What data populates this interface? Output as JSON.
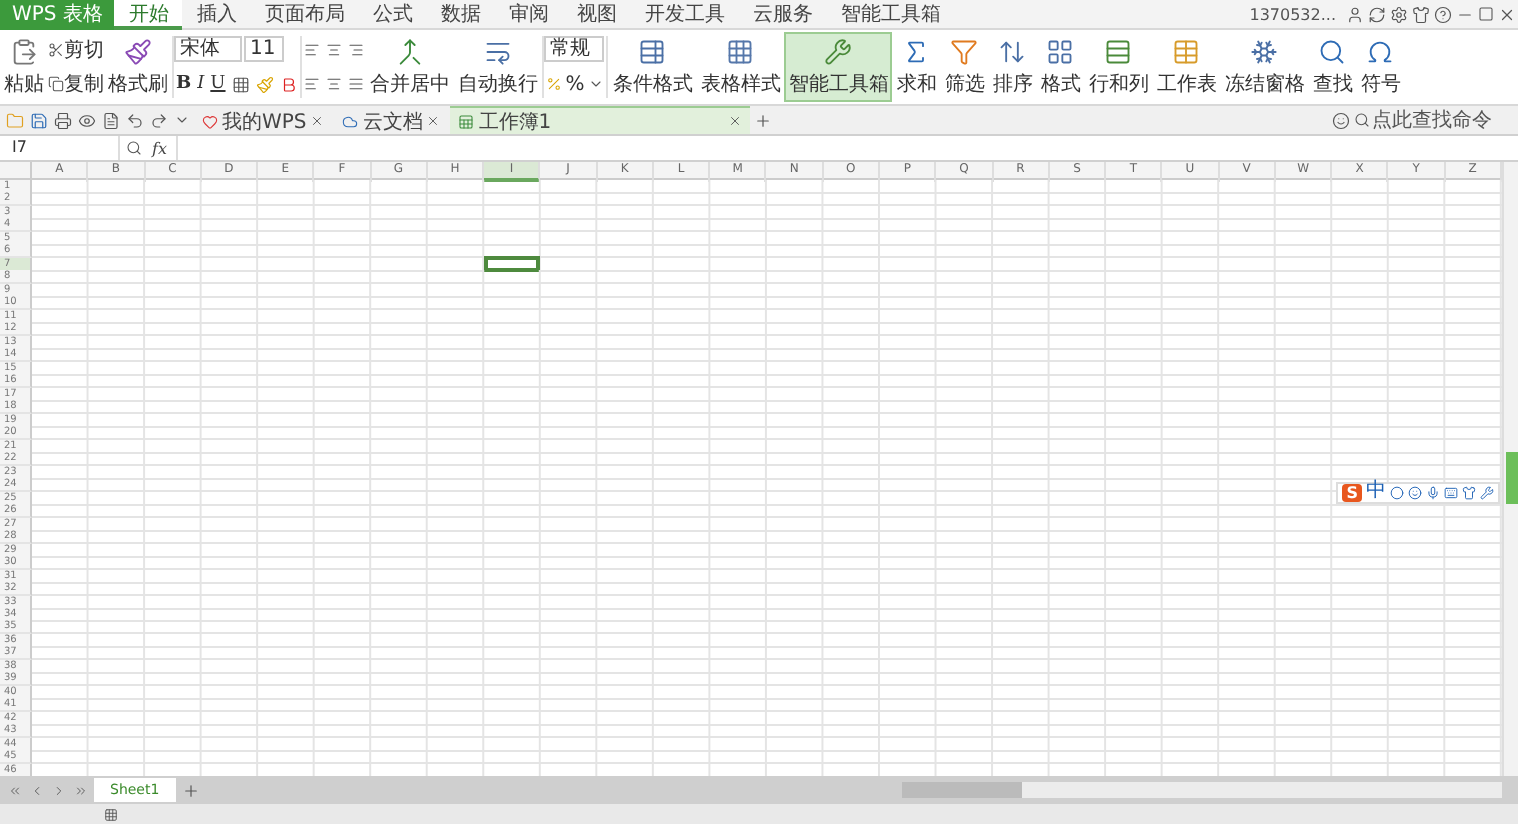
{
  "app_button": {
    "label": "WPS 表格"
  },
  "menu_tabs": [
    {
      "label": "开始",
      "selected": true
    },
    {
      "label": "插入",
      "selected": false
    },
    {
      "label": "页面布局",
      "selected": false
    },
    {
      "label": "公式",
      "selected": false
    },
    {
      "label": "数据",
      "selected": false
    },
    {
      "label": "审阅",
      "selected": false
    },
    {
      "label": "视图",
      "selected": false
    },
    {
      "label": "开发工具",
      "selected": false
    },
    {
      "label": "云服务",
      "selected": false
    },
    {
      "label": "智能工具箱",
      "selected": false
    }
  ],
  "user": {
    "name": "1370532..."
  },
  "ribbon": {
    "paste": "粘贴",
    "cut": "剪切",
    "copy": "复制",
    "format_painter": "格式刷",
    "font": "宋体",
    "font_size": "11",
    "format_letters": [
      "B",
      "I",
      "U"
    ],
    "big_buttons": [
      {
        "label": "合并居中",
        "selected": false
      },
      {
        "label": "自动换行",
        "selected": false
      }
    ],
    "number_format": "常规",
    "percent": "%",
    "tools": [
      {
        "label": "条件格式",
        "selected": false
      },
      {
        "label": "表格样式",
        "selected": false
      },
      {
        "label": "智能工具箱",
        "selected": true
      },
      {
        "label": "求和",
        "selected": false
      },
      {
        "label": "筛选",
        "selected": false
      },
      {
        "label": "排序",
        "selected": false
      },
      {
        "label": "格式",
        "selected": false
      },
      {
        "label": "行和列",
        "selected": false
      },
      {
        "label": "工作表",
        "selected": false
      },
      {
        "label": "冻结窗格",
        "selected": false
      },
      {
        "label": "查找",
        "selected": false
      },
      {
        "label": "符号",
        "selected": false
      }
    ]
  },
  "doc_tabs": [
    {
      "label": "我的WPS",
      "selected": false
    },
    {
      "label": "云文档",
      "selected": false
    },
    {
      "label": "工作簿1",
      "selected": true
    }
  ],
  "command_search": {
    "placeholder": "点此查找命令"
  },
  "formula_bar": {
    "name_box": "I7",
    "fx": "fx"
  },
  "columns": [
    {
      "label": "A",
      "selected": false
    },
    {
      "label": "B",
      "selected": false
    },
    {
      "label": "C",
      "selected": false
    },
    {
      "label": "D",
      "selected": false
    },
    {
      "label": "E",
      "selected": false
    },
    {
      "label": "F",
      "selected": false
    },
    {
      "label": "G",
      "selected": false
    },
    {
      "label": "H",
      "selected": false
    },
    {
      "label": "I",
      "selected": true
    },
    {
      "label": "J",
      "selected": false
    },
    {
      "label": "K",
      "selected": false
    },
    {
      "label": "L",
      "selected": false
    },
    {
      "label": "M",
      "selected": false
    },
    {
      "label": "N",
      "selected": false
    },
    {
      "label": "O",
      "selected": false
    },
    {
      "label": "P",
      "selected": false
    },
    {
      "label": "Q",
      "selected": false
    },
    {
      "label": "R",
      "selected": false
    },
    {
      "label": "S",
      "selected": false
    },
    {
      "label": "T",
      "selected": false
    },
    {
      "label": "U",
      "selected": false
    },
    {
      "label": "V",
      "selected": false
    },
    {
      "label": "W",
      "selected": false
    },
    {
      "label": "X",
      "selected": false
    },
    {
      "label": "Y",
      "selected": false
    },
    {
      "label": "Z",
      "selected": false
    }
  ],
  "rows": [
    {
      "label": "1",
      "selected": false
    },
    {
      "label": "2",
      "selected": false
    },
    {
      "label": "3",
      "selected": false
    },
    {
      "label": "4",
      "selected": false
    },
    {
      "label": "5",
      "selected": false
    },
    {
      "label": "6",
      "selected": false
    },
    {
      "label": "7",
      "selected": true
    },
    {
      "label": "8",
      "selected": false
    },
    {
      "label": "9",
      "selected": false
    },
    {
      "label": "10",
      "selected": false
    },
    {
      "label": "11",
      "selected": false
    },
    {
      "label": "12",
      "selected": false
    },
    {
      "label": "13",
      "selected": false
    },
    {
      "label": "14",
      "selected": false
    },
    {
      "label": "15",
      "selected": false
    },
    {
      "label": "16",
      "selected": false
    },
    {
      "label": "17",
      "selected": false
    },
    {
      "label": "18",
      "selected": false
    },
    {
      "label": "19",
      "selected": false
    },
    {
      "label": "20",
      "selected": false
    },
    {
      "label": "21",
      "selected": false
    },
    {
      "label": "22",
      "selected": false
    },
    {
      "label": "23",
      "selected": false
    },
    {
      "label": "24",
      "selected": false
    },
    {
      "label": "25",
      "selected": false
    },
    {
      "label": "26",
      "selected": false
    },
    {
      "label": "27",
      "selected": false
    },
    {
      "label": "28",
      "selected": false
    },
    {
      "label": "29",
      "selected": false
    },
    {
      "label": "30",
      "selected": false
    },
    {
      "label": "31",
      "selected": false
    },
    {
      "label": "32",
      "selected": false
    },
    {
      "label": "33",
      "selected": false
    },
    {
      "label": "34",
      "selected": false
    },
    {
      "label": "35",
      "selected": false
    },
    {
      "label": "36",
      "selected": false
    },
    {
      "label": "37",
      "selected": false
    },
    {
      "label": "38",
      "selected": false
    },
    {
      "label": "39",
      "selected": false
    },
    {
      "label": "40",
      "selected": false
    },
    {
      "label": "41",
      "selected": false
    },
    {
      "label": "42",
      "selected": false
    },
    {
      "label": "43",
      "selected": false
    },
    {
      "label": "44",
      "selected": false
    },
    {
      "label": "45",
      "selected": false
    },
    {
      "label": "46",
      "selected": false
    }
  ],
  "ime_bar": {
    "logo": "S",
    "mode": "中"
  },
  "sheet_tabs": [
    {
      "label": "Sheet1",
      "selected": true
    }
  ]
}
